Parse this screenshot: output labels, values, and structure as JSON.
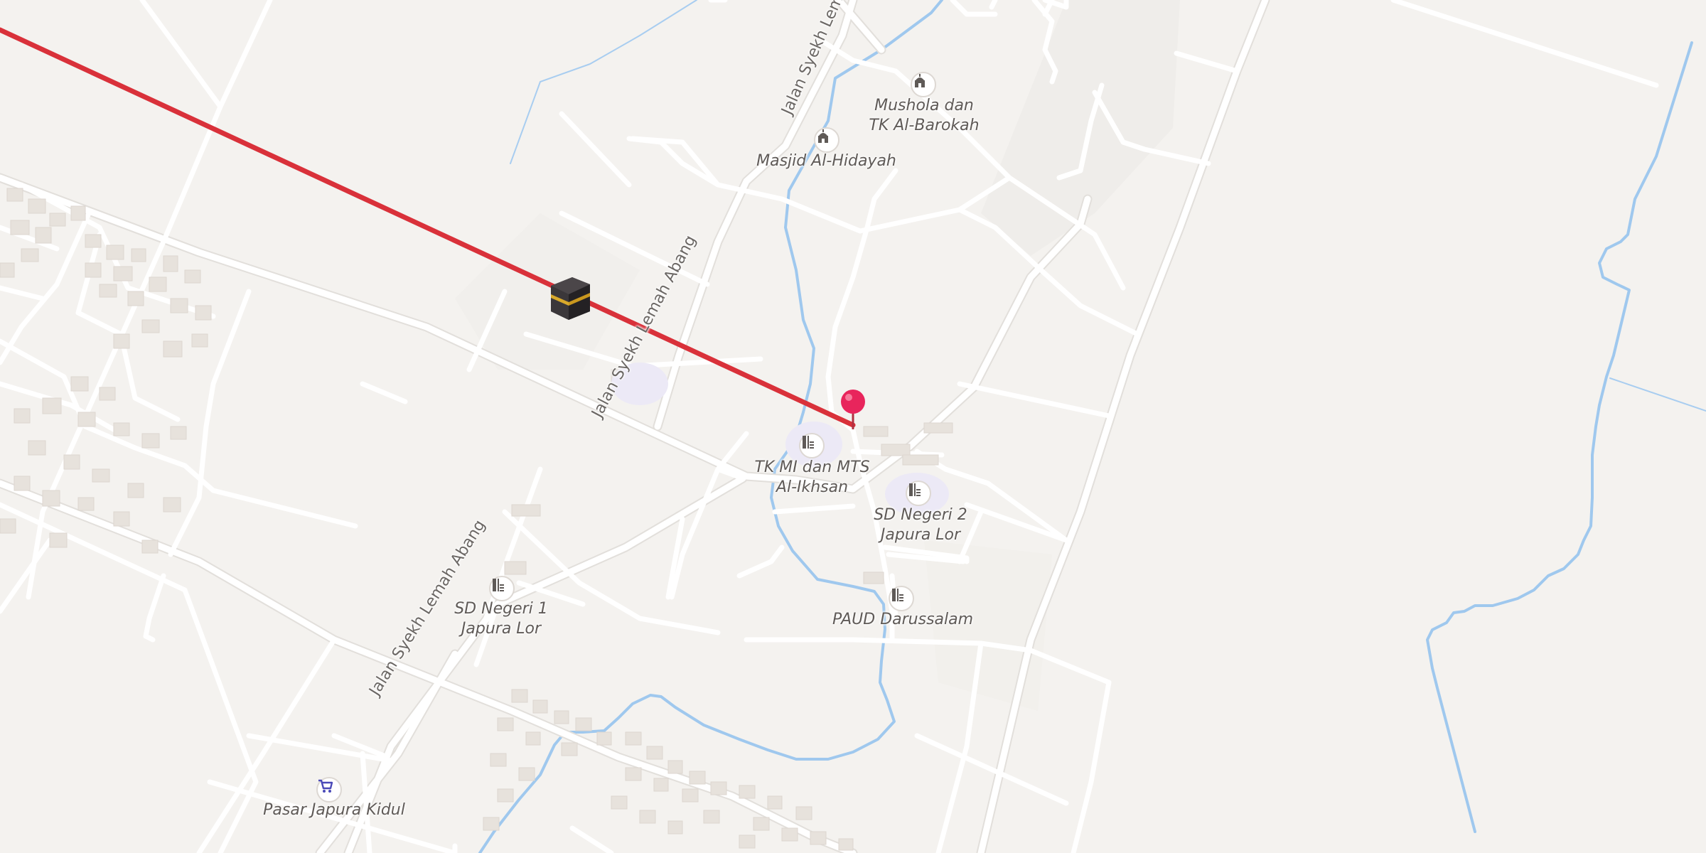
{
  "map": {
    "route_color": "#d9313a",
    "water_color": "#9fc8ee",
    "road_color": "#ffffff",
    "background_color": "#f4f2ef",
    "pin_color": "#e8255c",
    "streets": [
      {
        "id": "street1",
        "name": "Jalan Syekh Lemah Abang"
      },
      {
        "id": "street2",
        "name": "Jalan Syekh Lemah Abang"
      },
      {
        "id": "street3",
        "name": "Jalan Syekh Lemah Abang"
      }
    ],
    "places": [
      {
        "id": "mushola",
        "name": "Mushola dan\nTK Al-Barokah",
        "icon": "mosque-icon"
      },
      {
        "id": "masjid",
        "name": "Masjid Al-Hidayah",
        "icon": "mosque-icon"
      },
      {
        "id": "tk_mi",
        "name": "TK MI dan MTS\nAl-Ikhsan",
        "icon": "school-icon"
      },
      {
        "id": "sd2",
        "name": "SD Negeri 2\nJapura Lor",
        "icon": "school-icon"
      },
      {
        "id": "paud",
        "name": "PAUD Darussalam",
        "icon": "school-icon"
      },
      {
        "id": "sd1",
        "name": "SD Negeri 1\nJapura Lor",
        "icon": "school-icon"
      },
      {
        "id": "pasar",
        "name": "Pasar Japura Kidul",
        "icon": "shopping-cart-icon"
      }
    ],
    "markers": {
      "kaaba": "kaaba-icon",
      "location": "location-pin-icon"
    }
  }
}
